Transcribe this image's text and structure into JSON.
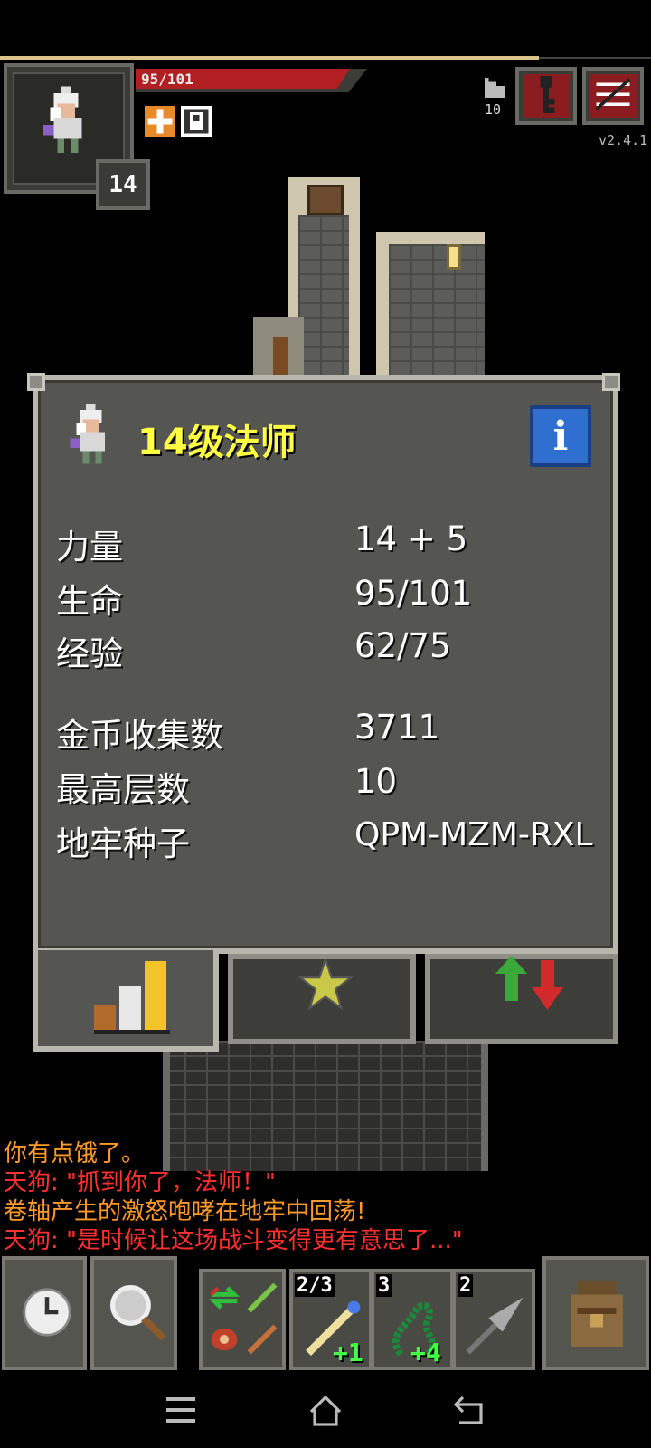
{
  "status": {
    "hp_text": "95/101",
    "hp_fraction": 0.94,
    "level": "14",
    "depth": "10",
    "version": "v2.4.1"
  },
  "dialog": {
    "title": "14级法师",
    "info_label": "i",
    "stats": [
      {
        "label": "力量",
        "value": "14 + 5"
      },
      {
        "label": "生命",
        "value": "95/101"
      },
      {
        "label": "经验",
        "value": "62/75"
      },
      {
        "label": "金币收集数",
        "value": "3711"
      },
      {
        "label": "最高层数",
        "value": "10"
      },
      {
        "label": "地牢种子",
        "value": "QPM-MZM-RXL"
      }
    ],
    "tabs": [
      "stats-icon",
      "star-icon",
      "arrows-icon"
    ]
  },
  "log": [
    {
      "text": "你有点饿了。",
      "color": "#ff9a2a"
    },
    {
      "text": "天狗: \"抓到你了，法师！\"",
      "color": "#ff3030"
    },
    {
      "text": "卷轴产生的激怒咆哮在地牢中回荡!",
      "color": "#ff9a2a"
    },
    {
      "text": "天狗: \"是时候让这场战斗变得更有意思了...\"",
      "color": "#ff3030"
    }
  ],
  "quickslots": [
    {
      "count": "2/3",
      "bonus": "+1",
      "icon": "wand-icon"
    },
    {
      "count": "3",
      "bonus": "+4",
      "icon": "whip-icon"
    },
    {
      "count": "2",
      "bonus": "",
      "icon": "dart-icon"
    }
  ],
  "colors": {
    "accent_yellow": "#ffff44",
    "hp_red": "#b11f22",
    "log_orange": "#ff9a2a",
    "log_red": "#ff3030"
  }
}
